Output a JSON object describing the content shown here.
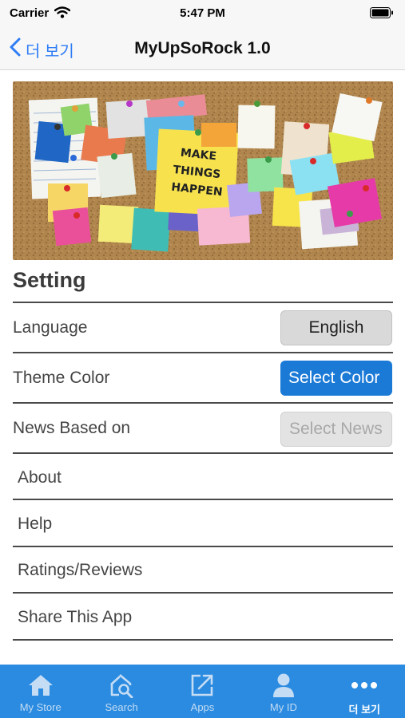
{
  "status_bar": {
    "carrier": "Carrier",
    "time": "5:47 PM"
  },
  "nav": {
    "back_label": "더 보기",
    "title": "MyUpSoRock 1.0"
  },
  "banner": {
    "note_text_line1": "MAKE",
    "note_text_line2": "THINGS",
    "note_text_line3": "HAPPEN"
  },
  "settings": {
    "title": "Setting",
    "rows": [
      {
        "label": "Language",
        "button": "English"
      },
      {
        "label": "Theme Color",
        "button": "Select Color"
      },
      {
        "label": "News Based on",
        "button": "Select News"
      }
    ]
  },
  "menu": {
    "items": [
      "About",
      "Help",
      "Ratings/Reviews",
      "Share This App"
    ]
  },
  "tabs": {
    "items": [
      {
        "label": "My Store",
        "icon": "home-icon"
      },
      {
        "label": "Search",
        "icon": "search-house-icon"
      },
      {
        "label": "Apps",
        "icon": "external-link-icon"
      },
      {
        "label": "My ID",
        "icon": "person-icon"
      },
      {
        "label": "더 보기",
        "icon": "more-dots-icon"
      }
    ]
  },
  "colors": {
    "accent": "#2e7cf6",
    "tab_bar": "#2a8be0",
    "theme_button": "#1c7ad7"
  }
}
